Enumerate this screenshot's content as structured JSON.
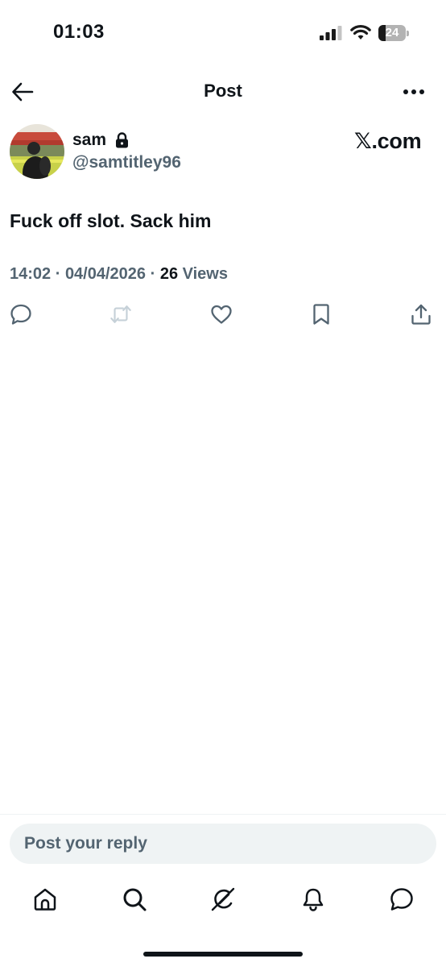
{
  "status_bar": {
    "time": "01:03",
    "battery_level": "24"
  },
  "header": {
    "title": "Post"
  },
  "author": {
    "display_name": "sam",
    "handle": "@samtitley96",
    "verified_lock": true
  },
  "brand": {
    "label": "𝕏.com"
  },
  "post": {
    "text": "Fuck off slot. Sack him",
    "time": "14:02",
    "date": "04/04/2026",
    "views_count": "26",
    "views_label": "Views"
  },
  "actions": [
    "reply-icon",
    "repost-icon",
    "like-icon",
    "bookmark-icon",
    "share-icon"
  ],
  "composer": {
    "placeholder": "Post your reply"
  },
  "tab_bar": [
    "home-icon",
    "search-icon",
    "grok-icon",
    "notifications-icon",
    "messages-icon"
  ],
  "colors": {
    "text": "#0f1419",
    "secondary": "#536471",
    "surface": "#eff3f4",
    "repost_disabled": "#c6d1d8"
  }
}
